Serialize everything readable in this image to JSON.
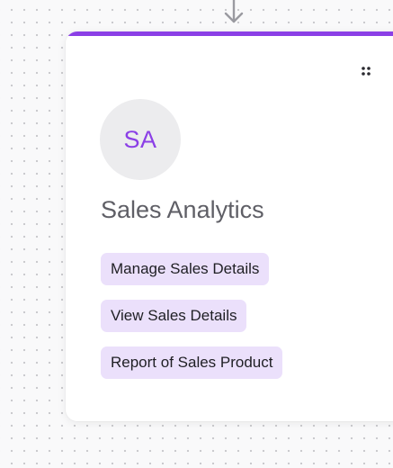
{
  "canvas": {
    "connector_icon": "arrow-down-icon"
  },
  "node": {
    "accent_color": "#8b3fe6",
    "drag_handle_icon": "drag-handle-icon",
    "avatar": {
      "initials": "SA",
      "background": "#ececee",
      "text_color": "#8b3fe6"
    },
    "title": "Sales Analytics",
    "actions": [
      {
        "label": "Manage Sales Details"
      },
      {
        "label": "View Sales Details"
      },
      {
        "label": "Report of Sales Product"
      }
    ],
    "tag_background": "#ebe0fb"
  }
}
